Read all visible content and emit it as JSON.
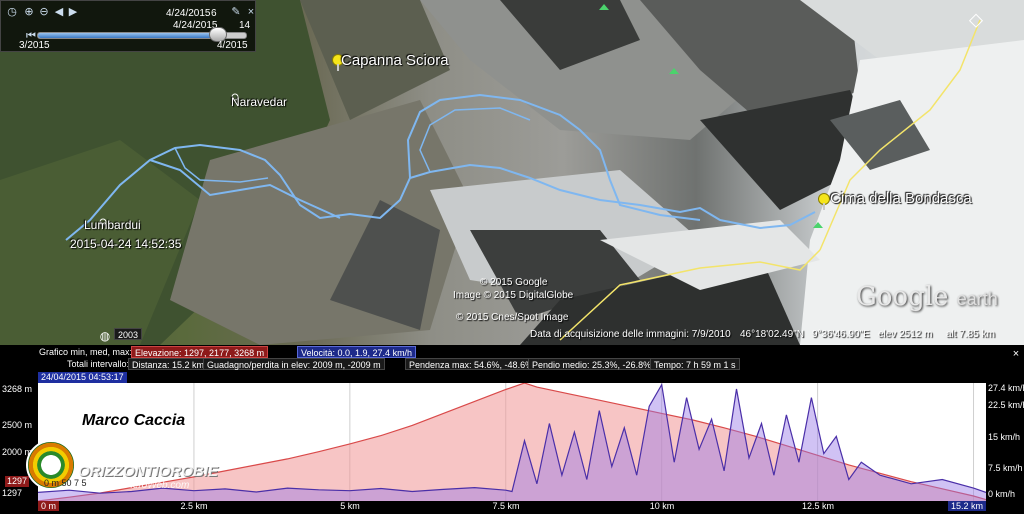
{
  "timebar": {
    "date_top": "4/24/2015",
    "speed": "6",
    "date_mid": "4/24/2015",
    "frame": "14",
    "start_label": "3/2015",
    "end_label": "4/2015",
    "progress": 0.88
  },
  "map": {
    "places": {
      "capanna": "Capanna Sciora",
      "naravedar": "Naravedar",
      "lumbardui": "Lumbardui",
      "cima": "Cima della Bondasca"
    },
    "timestamp_label": "2015-04-24 14:52:35",
    "credits": {
      "google": "© 2015 Google",
      "digitalglobe": "Image © 2015 DigitalGlobe",
      "cnes": "© 2015 Cnes/Spot Image"
    },
    "logo_word1": "Google",
    "logo_word2": "earth",
    "year_badge": "2003",
    "status": {
      "acquisition": "Data di acquisizione delle immagini: 7/9/2010",
      "lat": "46°18'02.49\"N",
      "lon": "9°36'46.90\"E",
      "elev": "elev  2512 m",
      "alt": "alt  7.85 km"
    },
    "track_color": "#7fb7f0"
  },
  "profile": {
    "graph_label": "Grafico  min, med, max:",
    "elevation_label": "Elevazione: 1297, 2177, 3268 m",
    "velocity_label": "Velocità: 0.0, 1.9, 27.4 km/h",
    "totals_label": "Totali intervallo:",
    "distance_label": "Distanza: 15.2 km",
    "gain_label": "Guadagno/perdita in elev:  2009 m, -2009 m",
    "slope_max_label": "Pendenza max:  54.6%, -48.6%",
    "slope_avg_label": "Pendio medio:  25.3%, -26.8%",
    "time_label": "Tempo:  7 h 59 m 1 s",
    "date_badge": "24/04/2015 04:53:17",
    "close": "×",
    "y_left": [
      "3268 m",
      "2500 m",
      "2000 m",
      "1297"
    ],
    "y_right": [
      "27.4 km/h",
      "22.5 km/h",
      "15 km/h",
      "7.5 km/h",
      "0 km/h"
    ],
    "min_left_badge": "1297",
    "min_left_badge2": "1297",
    "x_labels": [
      "0 m",
      "2.5 km",
      "5 km",
      "7.5 km",
      "10 km",
      "12.5 km",
      "15.2 km"
    ],
    "watermark_name": "Marco Caccia",
    "logo_text": "ORIZZONTIOROBIE",
    "logo_url": "www.PieroWeb.com",
    "inline_speed_label": "0 m  50 7 5"
  },
  "chart_data": {
    "type": "area",
    "xlabel": "",
    "ylabel": "",
    "x_unit": "km",
    "xlim": [
      0,
      15.2
    ],
    "series": [
      {
        "name": "Elevazione",
        "unit": "m",
        "ylim": [
          1297,
          3268
        ],
        "color": "#d94a4a",
        "x": [
          0,
          0.5,
          1.0,
          1.5,
          2.0,
          2.5,
          3.0,
          3.5,
          4.0,
          4.5,
          5.0,
          5.5,
          6.0,
          6.5,
          7.0,
          7.5,
          7.8,
          8.0,
          8.5,
          9.0,
          9.5,
          10.0,
          10.5,
          11.0,
          11.5,
          12.0,
          12.5,
          13.0,
          13.5,
          14.0,
          14.5,
          15.0,
          15.2
        ],
        "values": [
          1297,
          1360,
          1430,
          1520,
          1610,
          1700,
          1800,
          1900,
          2000,
          2120,
          2250,
          2390,
          2560,
          2760,
          2960,
          3160,
          3268,
          3200,
          3090,
          2980,
          2870,
          2760,
          2650,
          2520,
          2380,
          2220,
          2060,
          1900,
          1760,
          1620,
          1500,
          1380,
          1320
        ]
      },
      {
        "name": "Velocità",
        "unit": "km/h",
        "ylim": [
          0,
          27.4
        ],
        "color": "#4a2fa8",
        "x": [
          0,
          0.5,
          1.0,
          1.5,
          2.0,
          2.5,
          3.0,
          3.5,
          4.0,
          4.5,
          5.0,
          5.5,
          6.0,
          6.5,
          7.0,
          7.5,
          7.6,
          7.8,
          8.0,
          8.2,
          8.4,
          8.6,
          8.8,
          9.0,
          9.2,
          9.4,
          9.6,
          9.8,
          10.0,
          10.2,
          10.4,
          10.6,
          10.8,
          11.0,
          11.2,
          11.4,
          11.6,
          11.8,
          12.0,
          12.2,
          12.4,
          12.6,
          12.8,
          13.0,
          13.2,
          13.5,
          14.0,
          14.5,
          15.0,
          15.2
        ],
        "values": [
          2,
          2.5,
          1.8,
          2.2,
          3,
          2.4,
          2.8,
          2.1,
          3,
          2.6,
          2.4,
          2.9,
          2.2,
          2.7,
          3.1,
          2.5,
          2.2,
          14,
          4,
          18,
          6,
          16,
          5,
          21,
          8,
          17,
          6,
          22,
          27,
          9,
          24,
          12,
          19,
          7,
          26,
          10,
          18,
          6,
          20,
          9,
          24,
          11,
          15,
          5,
          9,
          6,
          4,
          5,
          3,
          2
        ]
      }
    ]
  }
}
